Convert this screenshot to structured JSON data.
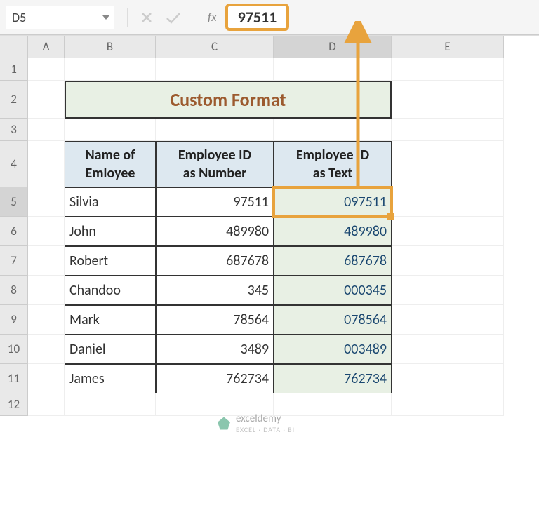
{
  "name_box": "D5",
  "formula_value": "97511",
  "fx_label": "fx",
  "columns": [
    "A",
    "B",
    "C",
    "D",
    "E"
  ],
  "rows": [
    "1",
    "2",
    "3",
    "4",
    "5",
    "6",
    "7",
    "8",
    "9",
    "10",
    "11",
    "12"
  ],
  "title": "Custom Format",
  "headers": {
    "name": "Name of\nEmloyee",
    "id_num": "Employee ID\nas Number",
    "id_text": "Employee ID\nas Text"
  },
  "table": [
    {
      "name": "Silvia",
      "num": "97511",
      "text": "097511"
    },
    {
      "name": "John",
      "num": "489980",
      "text": "489980"
    },
    {
      "name": "Robert",
      "num": "687678",
      "text": "687678"
    },
    {
      "name": "Chandoo",
      "num": "345",
      "text": "000345"
    },
    {
      "name": "Mark",
      "num": "78564",
      "text": "078564"
    },
    {
      "name": "Daniel",
      "num": "3489",
      "text": "003489"
    },
    {
      "name": "James",
      "num": "762734",
      "text": "762734"
    }
  ],
  "watermark": {
    "brand": "exceldemy",
    "sub": "EXCEL · DATA · BI"
  }
}
